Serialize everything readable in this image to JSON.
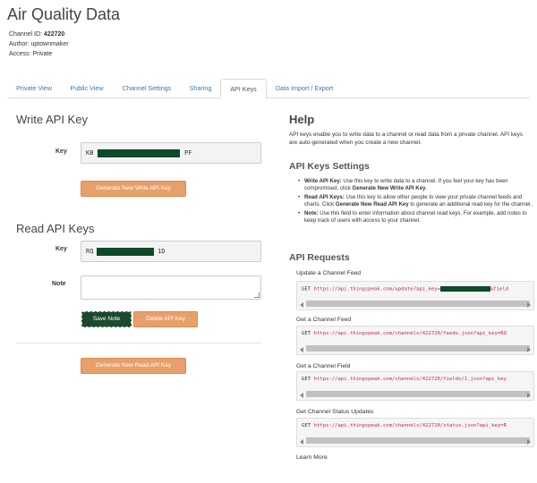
{
  "header": {
    "title": "Air Quality Data",
    "channel_id_label": "Channel ID:",
    "channel_id": "422720",
    "author": "Author: uptownmaker",
    "access": "Access: Private"
  },
  "tabs": [
    {
      "label": "Private View"
    },
    {
      "label": "Public View"
    },
    {
      "label": "Channel Settings"
    },
    {
      "label": "Sharing"
    },
    {
      "label": "API Keys"
    },
    {
      "label": "Data Import / Export"
    }
  ],
  "write_key": {
    "heading": "Write API Key",
    "key_label": "Key",
    "value_prefix": "KB",
    "value_suffix": "PF",
    "button": "Generate New Write API Key"
  },
  "read_keys": {
    "heading": "Read API Keys",
    "key_label": "Key",
    "value_prefix": "RQ",
    "value_suffix": "1D",
    "note_label": "Note",
    "save_button": "Save Note",
    "delete_button": "Delete API Key",
    "generate_button": "Generate New Read API Key"
  },
  "help": {
    "title": "Help",
    "intro": "API keys enable you to write data to a channel or read data from a private channel. API keys are auto-generated when you create a new channel.",
    "settings_heading": "API Keys Settings",
    "bullets": [
      {
        "term": "Write API Key:",
        "text": " Use this key to write data to a channel. If you feel your key has been compromised, click ",
        "strong": "Generate New Write API Key",
        "end": "."
      },
      {
        "term": "Read API Keys:",
        "text": " Use this key to allow other people to view your private channel feeds and charts. Click ",
        "strong": "Generate New Read API Key",
        "end": " to generate an additional read key for the channel."
      },
      {
        "term": "Note:",
        "text": " Use this field to enter information about channel read keys. For example, add notes to keep track of users with access to your channel.",
        "strong": "",
        "end": ""
      }
    ],
    "requests_heading": "API Requests",
    "requests": [
      {
        "title": "Update a Channel Feed",
        "method": "GET",
        "url": "https://api.thingspeak.com/update?api_key=",
        "tail": "&field"
      },
      {
        "title": "Get a Channel Feed",
        "method": "GET",
        "url": "https://api.thingspeak.com/channels/422720/feeds.json?api_key=RQ",
        "tail": ""
      },
      {
        "title": "Get a Channel Field",
        "method": "GET",
        "url": "https://api.thingspeak.com/channels/422720/fields/1.json?api_key",
        "tail": ""
      },
      {
        "title": "Get Channel Status Updates",
        "method": "GET",
        "url": "https://api.thingspeak.com/channels/422720/status.json?api_key=R",
        "tail": ""
      }
    ],
    "learn_more": "Learn More"
  },
  "colors": {
    "accent_button": "#e8a06a",
    "link": "#337ab7",
    "redaction": "#0e4a2a"
  }
}
